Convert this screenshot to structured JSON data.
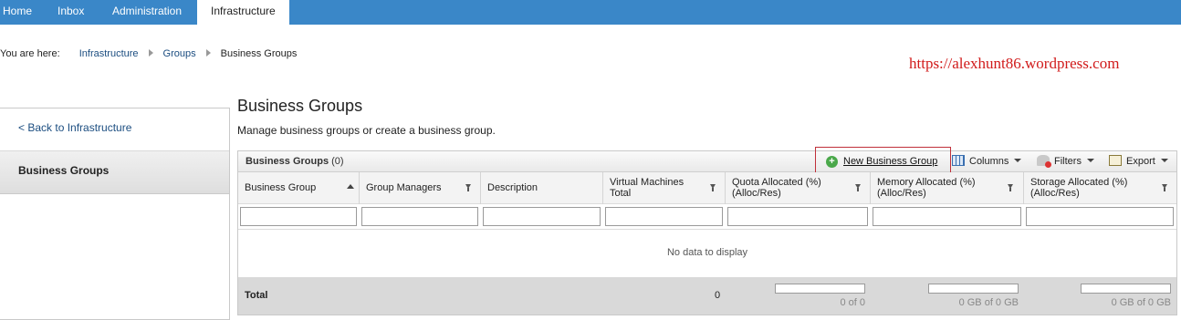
{
  "nav": {
    "tabs": [
      {
        "label": "Home"
      },
      {
        "label": "Inbox"
      },
      {
        "label": "Administration"
      },
      {
        "label": "Infrastructure",
        "active": true
      }
    ]
  },
  "breadcrumb": {
    "prefix": "You are here:",
    "items": [
      "Infrastructure",
      "Groups",
      "Business Groups"
    ]
  },
  "watermark": "https://alexhunt86.wordpress.com",
  "sidebar": {
    "back_label": "< Back to Infrastructure",
    "active_label": "Business Groups"
  },
  "main": {
    "title": "Business Groups",
    "description": "Manage business groups or create a business group."
  },
  "grid": {
    "title": "Business Groups",
    "count": "(0)",
    "toolbar": {
      "new_label": "New Business Group",
      "columns_label": "Columns",
      "filters_label": "Filters",
      "export_label": "Export"
    },
    "columns": [
      {
        "line1": "Business Group",
        "line2": ""
      },
      {
        "line1": "Group Managers",
        "line2": ""
      },
      {
        "line1": "Description",
        "line2": ""
      },
      {
        "line1": "Virtual Machines",
        "line2": "Total"
      },
      {
        "line1": "Quota Allocated (%)",
        "line2": "(Alloc/Res)"
      },
      {
        "line1": "Memory Allocated (%)",
        "line2": "(Alloc/Res)"
      },
      {
        "line1": "Storage Allocated (%)",
        "line2": "(Alloc/Res)"
      }
    ],
    "empty_text": "No data to display",
    "total": {
      "label": "Total",
      "vm_total": "0",
      "quota": "0 of 0",
      "memory": "0 GB of 0 GB",
      "storage": "0 GB of 0 GB"
    }
  },
  "colors": {
    "nav_bg": "#3a87c8",
    "link": "#1b4d80",
    "watermark": "#d11b1b",
    "highlight_border": "#c0303a",
    "total_row_bg": "#d9d9d9"
  }
}
